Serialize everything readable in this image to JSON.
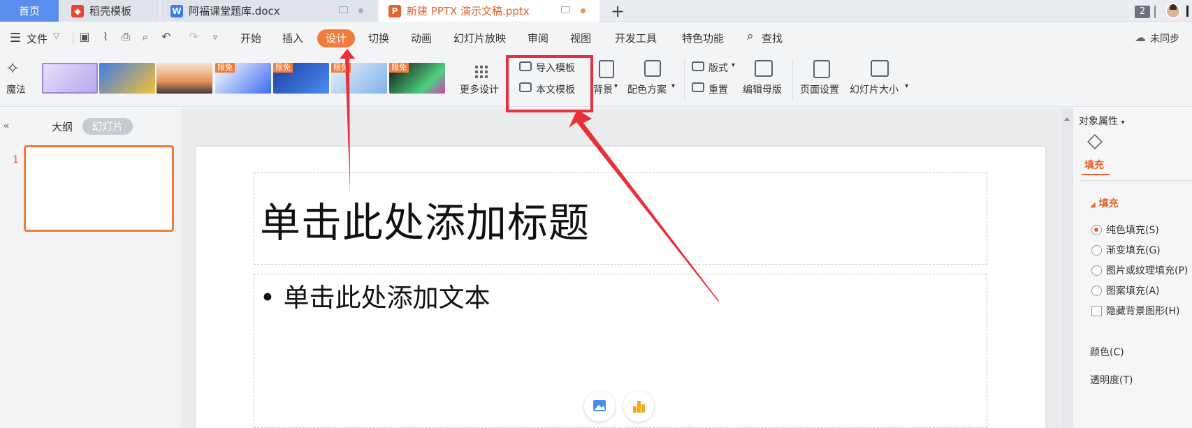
{
  "tabs": {
    "home": "首页",
    "t1": "稻壳模板",
    "t2": "阿福课堂题库.docx",
    "t3": "新建 PPTX 演示文稿.pptx",
    "count": "2"
  },
  "menu": {
    "file": "文件",
    "items": [
      "开始",
      "插入",
      "设计",
      "切换",
      "动画",
      "幻灯片放映",
      "审阅",
      "视图",
      "开发工具",
      "特色功能",
      "查找"
    ],
    "sync": "未同步"
  },
  "ribbon": {
    "magic": "魔法",
    "badge": "限免",
    "more_design": "更多设计",
    "import_template": "导入模板",
    "this_template": "本文模板",
    "background": "背景",
    "color_scheme": "配色方案",
    "layout": "版式",
    "reset": "重置",
    "edit_master": "编辑母版",
    "page_setup": "页面设置",
    "slide_size": "幻灯片大小"
  },
  "left_panel": {
    "outline": "大纲",
    "slides": "幻灯片",
    "slide_number": "1"
  },
  "slide": {
    "title_placeholder": "单击此处添加标题",
    "body_placeholder": "单击此处添加文本"
  },
  "right_panel": {
    "title": "对象属性",
    "tab_fill": "填充",
    "section_fill": "填充",
    "options": [
      "纯色填充(S)",
      "渐变填充(G)",
      "图片或纹理填充(P)",
      "图案填充(A)"
    ],
    "hide_bg": "隐藏背景图形(H)",
    "color": "颜色(C)",
    "transparency": "透明度(T)"
  },
  "colors": {
    "accent": "#f07c3c",
    "annotation_red": "#e8303a",
    "tab_home": "#5b8def"
  }
}
